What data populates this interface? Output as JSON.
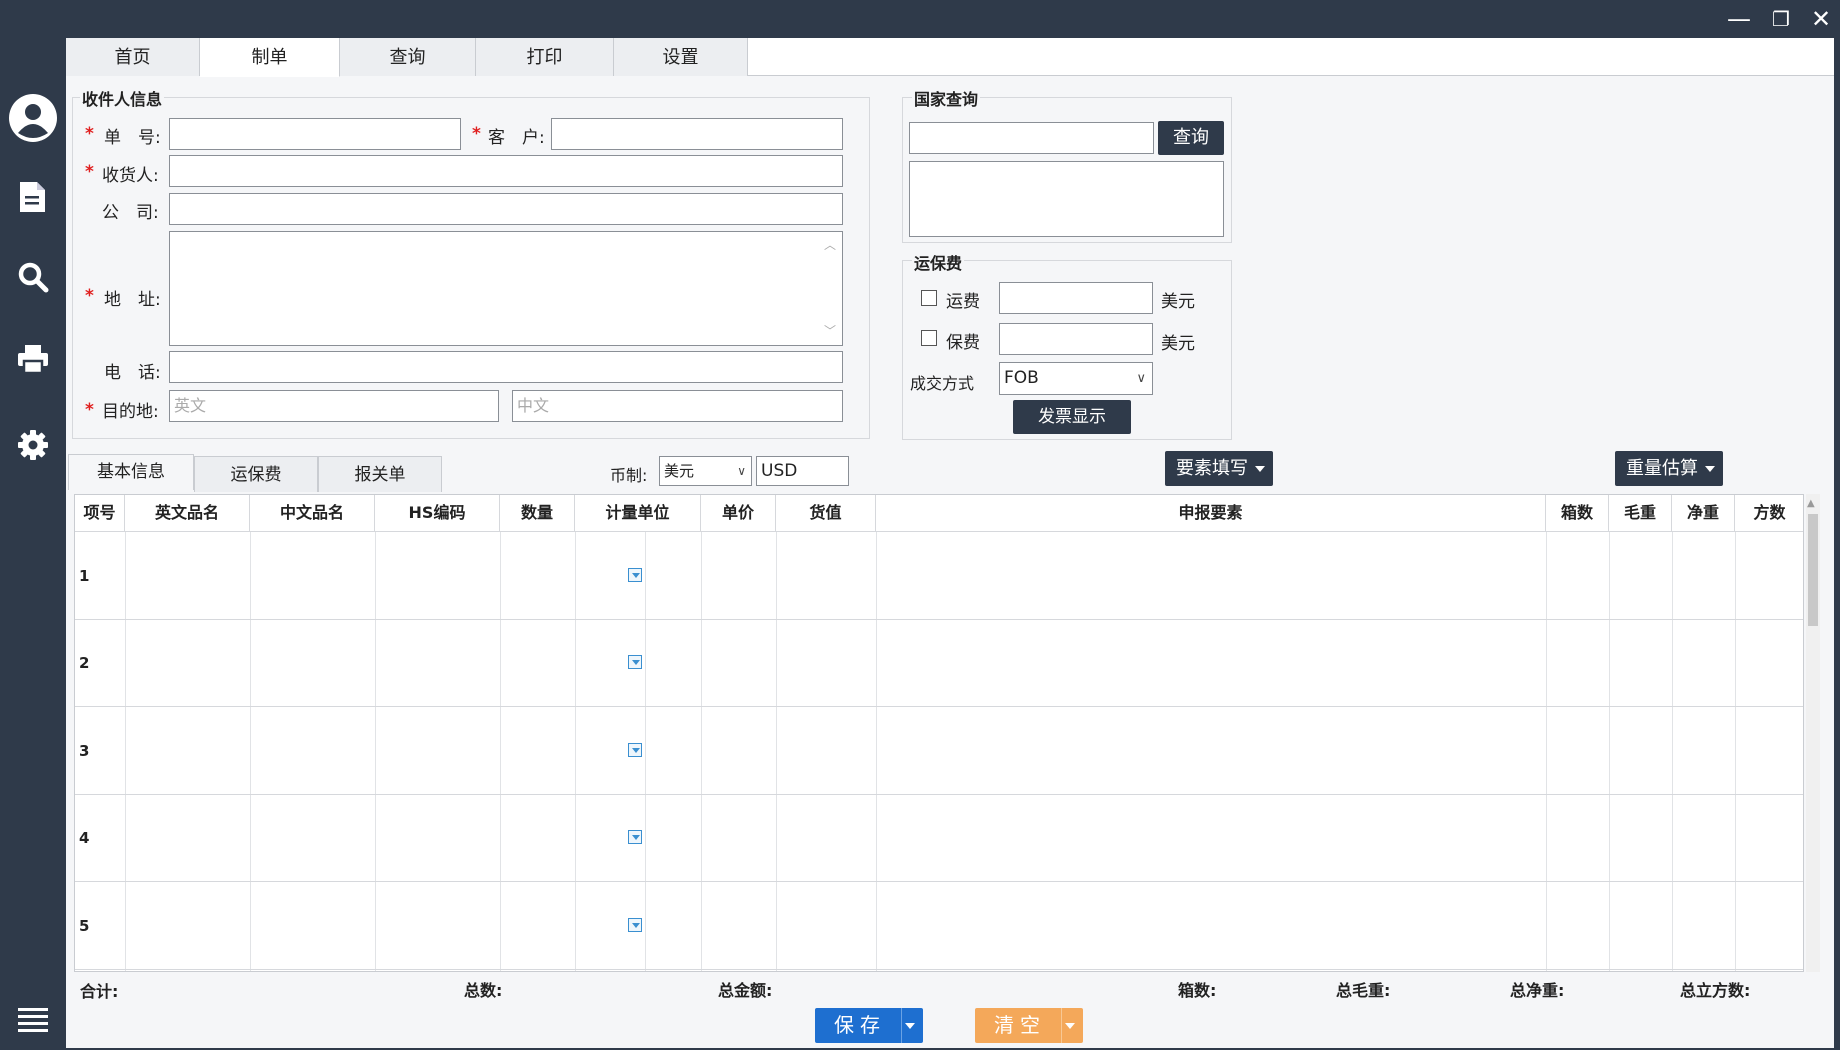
{
  "window": {
    "minimize": "—",
    "restore": "❐",
    "close": "✕"
  },
  "top_tabs": [
    "首页",
    "制单",
    "查询",
    "打印",
    "设置"
  ],
  "recipient": {
    "title": "收件人信息",
    "order_no_label": "单　号:",
    "customer_label": "客　户:",
    "consignee_label": "收货人:",
    "company_label": "公　司:",
    "address_label": "地　址:",
    "phone_label": "电　话:",
    "destination_label": "目的地:",
    "dest_en_placeholder": "英文",
    "dest_cn_placeholder": "中文"
  },
  "country_query": {
    "title": "国家查询",
    "button": "查询"
  },
  "freight": {
    "title": "运保费",
    "freight_label": "运费",
    "insurance_label": "保费",
    "unit": "美元",
    "trade_term_label": "成交方式",
    "trade_term": "FOB",
    "invoice_button": "发票显示"
  },
  "sub_tabs": [
    "基本信息",
    "运保费",
    "报关单"
  ],
  "currency": {
    "label": "币制:",
    "name": "美元",
    "code": "USD"
  },
  "elements_button": "要素填写",
  "weight_button": "重量估算",
  "grid": {
    "columns": [
      "项号",
      "英文品名",
      "中文品名",
      "HS编码",
      "数量",
      "计量单位",
      "单价",
      "货值",
      "申报要素",
      "箱数",
      "毛重",
      "净重",
      "方数"
    ],
    "rows": [
      "1",
      "2",
      "3",
      "4",
      "5"
    ]
  },
  "summary": {
    "total": "合计:",
    "count": "总数:",
    "amount": "总金额:",
    "boxes": "箱数:",
    "gross": "总毛重:",
    "net": "总净重:",
    "volume": "总立方数:"
  },
  "actions": {
    "save": "保存",
    "clear": "清空"
  },
  "colors": {
    "sidebar": "#2f3a4a",
    "save": "#1e6fd0",
    "clear": "#f4a85a",
    "required": "#e02020"
  }
}
